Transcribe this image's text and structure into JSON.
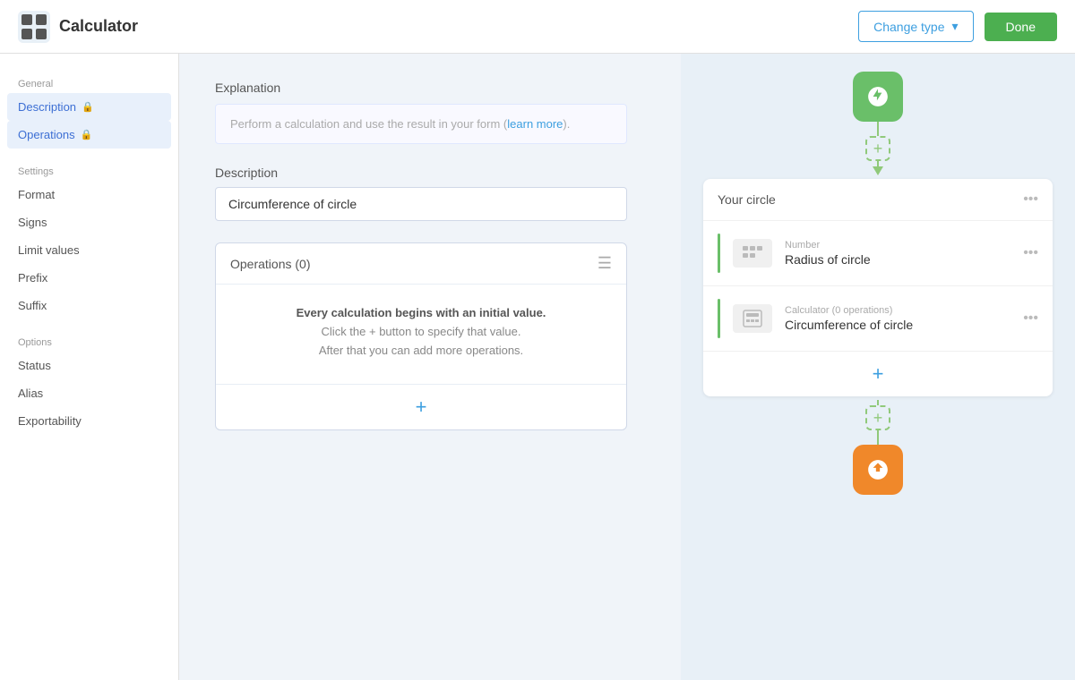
{
  "header": {
    "title": "Calculator",
    "change_type_label": "Change type",
    "done_label": "Done"
  },
  "sidebar": {
    "general_label": "General",
    "settings_label": "Settings",
    "options_label": "Options",
    "items_general": [
      {
        "id": "description",
        "label": "Description",
        "lock": true,
        "active": true
      },
      {
        "id": "operations",
        "label": "Operations",
        "lock": true,
        "active": true
      }
    ],
    "items_settings": [
      {
        "id": "format",
        "label": "Format",
        "lock": false
      },
      {
        "id": "signs",
        "label": "Signs",
        "lock": false
      },
      {
        "id": "limit-values",
        "label": "Limit values",
        "lock": false
      },
      {
        "id": "prefix",
        "label": "Prefix",
        "lock": false
      },
      {
        "id": "suffix",
        "label": "Suffix",
        "lock": false
      }
    ],
    "items_options": [
      {
        "id": "status",
        "label": "Status",
        "lock": false
      },
      {
        "id": "alias",
        "label": "Alias",
        "lock": false
      },
      {
        "id": "exportability",
        "label": "Exportability",
        "lock": false
      }
    ]
  },
  "main": {
    "explanation_section": "Explanation",
    "explanation_placeholder": "Perform a calculation and use the result in your form (",
    "explanation_link": "learn more",
    "explanation_suffix": ").",
    "description_label": "Description",
    "description_value": "Circumference of circle",
    "operations_title": "Operations (0)",
    "operations_msg1": "Every calculation begins with an initial value.",
    "operations_msg2": "Click the + button to specify that value.",
    "operations_msg3": "After that you can add more operations."
  },
  "flow": {
    "card_title": "Your circle",
    "row1_type": "Number",
    "row1_name": "Radius of circle",
    "row2_type": "Calculator (0 operations)",
    "row2_name": "Circumference of circle"
  }
}
